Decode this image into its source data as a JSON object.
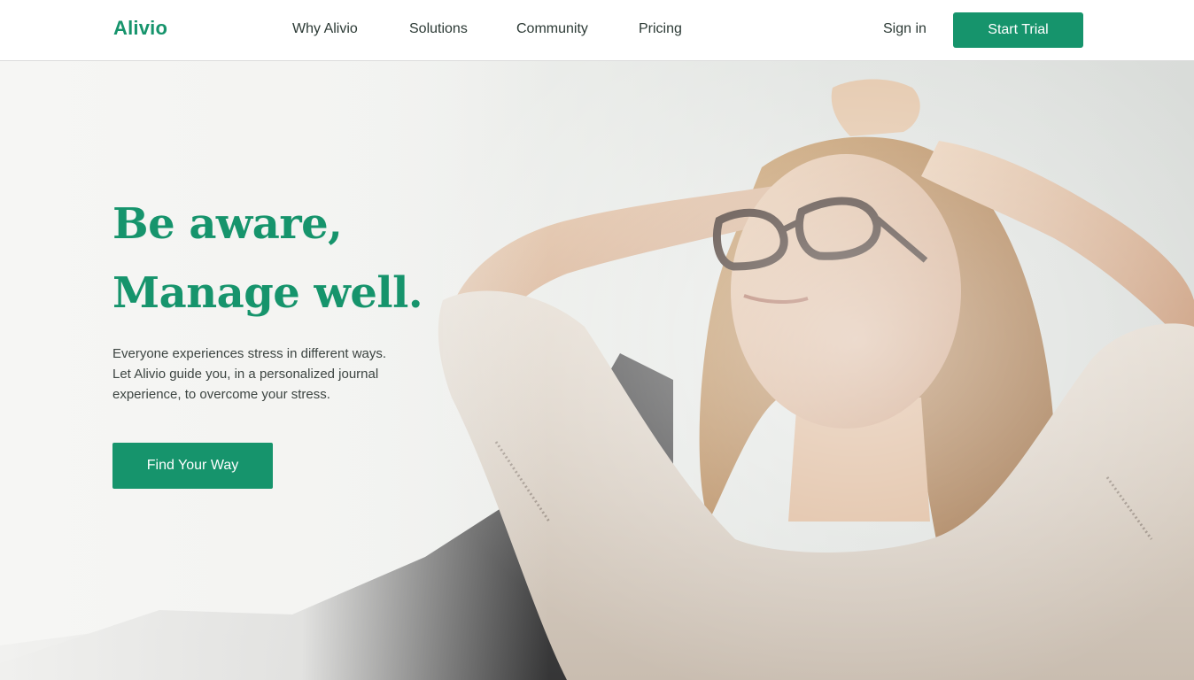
{
  "brand": {
    "name": "Alivio",
    "accent": "#16946c"
  },
  "nav": {
    "items": [
      {
        "label": "Why Alivio"
      },
      {
        "label": "Solutions"
      },
      {
        "label": "Community"
      },
      {
        "label": "Pricing"
      }
    ],
    "sign_in": "Sign in",
    "start_trial": "Start Trial"
  },
  "hero": {
    "headline": [
      "Be aware,",
      "Manage well."
    ],
    "subcopy": [
      "Everyone experiences stress in different ways.",
      "Let Alivio guide you, in a personalized journal",
      "experience, to overcome your stress."
    ],
    "cta": "Find Your Way"
  }
}
